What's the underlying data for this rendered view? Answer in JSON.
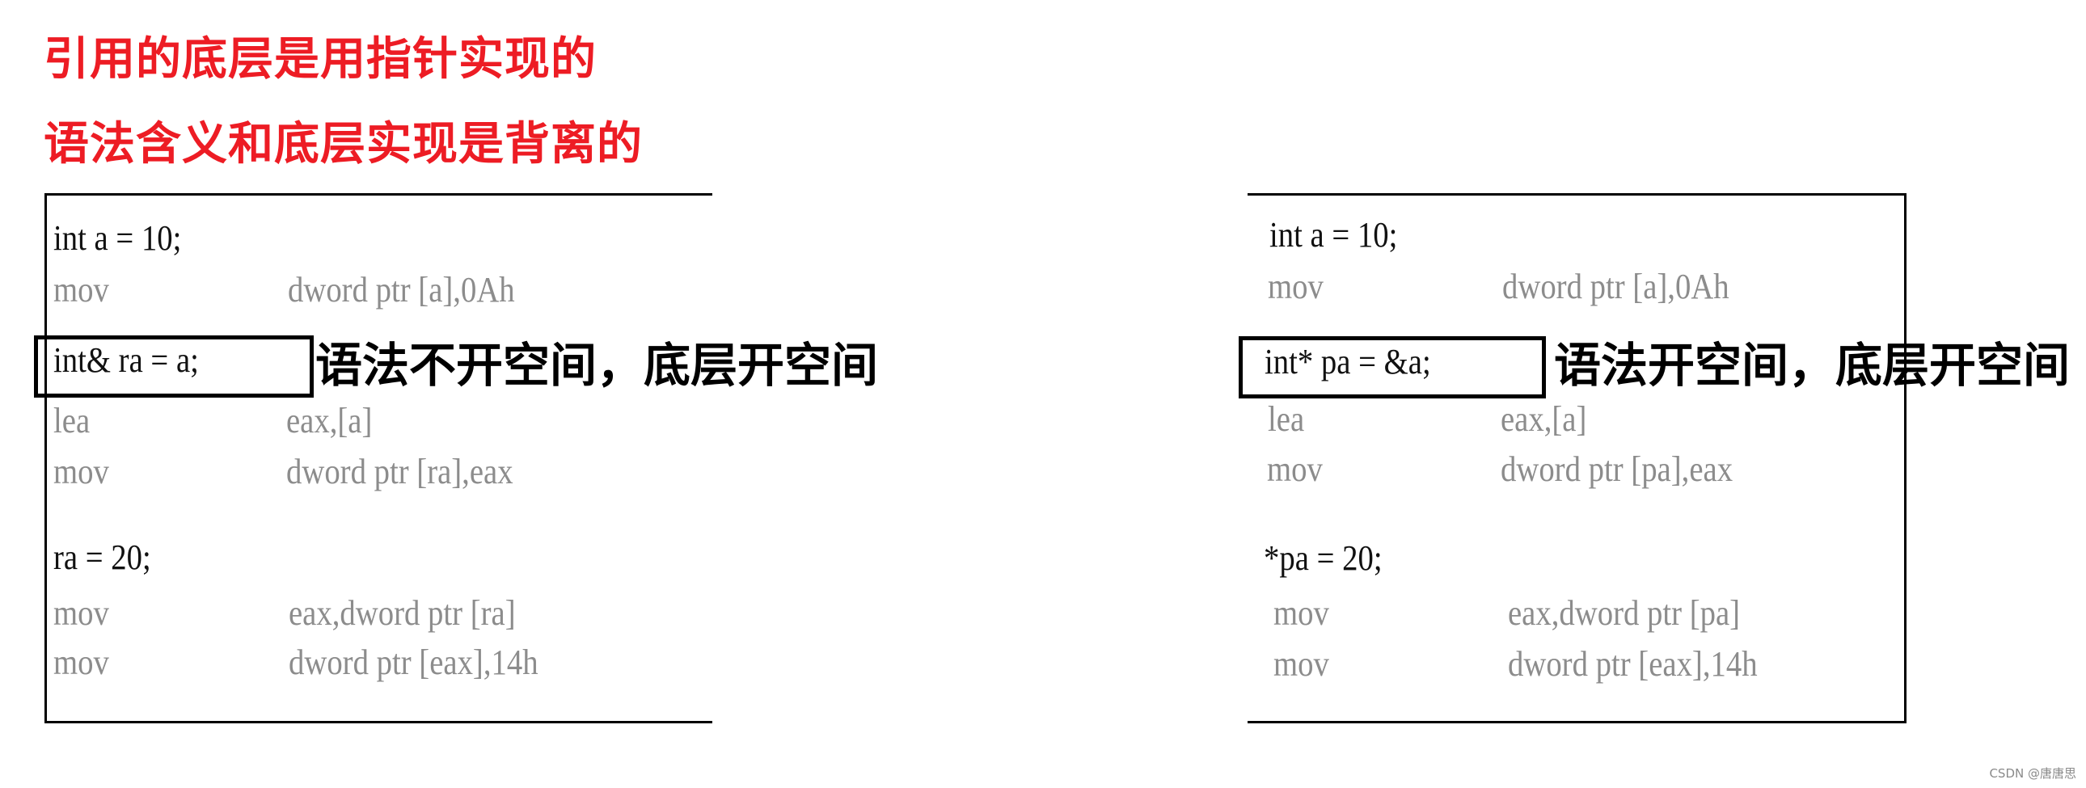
{
  "titles": {
    "line1": "引用的底层是用指针实现的",
    "line2": "语法含义和底层实现是背离的",
    "color": "#ED1C24"
  },
  "left_panel": {
    "lines": [
      {
        "kind": "source",
        "text": "int a = 10;"
      },
      {
        "kind": "asm",
        "mnemonic": "mov",
        "operands": "dword ptr [a],0Ah"
      },
      {
        "kind": "source",
        "text": "int& ra = a;",
        "highlighted": true
      },
      {
        "kind": "asm",
        "mnemonic": "lea",
        "operands": "eax,[a]"
      },
      {
        "kind": "asm",
        "mnemonic": "mov",
        "operands": "dword ptr [ra],eax"
      },
      {
        "kind": "source",
        "text": "ra = 20;"
      },
      {
        "kind": "asm",
        "mnemonic": "mov",
        "operands": "eax,dword ptr [ra]"
      },
      {
        "kind": "asm",
        "mnemonic": "mov",
        "operands": "dword ptr [eax],14h"
      }
    ],
    "annotation": "语法不开空间，底层开空间"
  },
  "right_panel": {
    "lines": [
      {
        "kind": "source",
        "text": "int a = 10;"
      },
      {
        "kind": "asm",
        "mnemonic": "mov",
        "operands": "dword ptr [a],0Ah"
      },
      {
        "kind": "source",
        "text": "int* pa = &a;",
        "highlighted": true
      },
      {
        "kind": "asm",
        "mnemonic": "lea",
        "operands": "eax,[a]"
      },
      {
        "kind": "asm",
        "mnemonic": "mov",
        "operands": "dword ptr [pa],eax"
      },
      {
        "kind": "source",
        "text": "*pa = 20;"
      },
      {
        "kind": "asm",
        "mnemonic": "mov",
        "operands": "eax,dword ptr [pa]"
      },
      {
        "kind": "asm",
        "mnemonic": "mov",
        "operands": "dword ptr [eax],14h"
      }
    ],
    "annotation": "语法开空间，底层开空间"
  },
  "colors": {
    "source_text": "#111111",
    "asm_text": "#8c8c8c",
    "border": "#000000"
  },
  "watermark": "CSDN @唐唐思"
}
